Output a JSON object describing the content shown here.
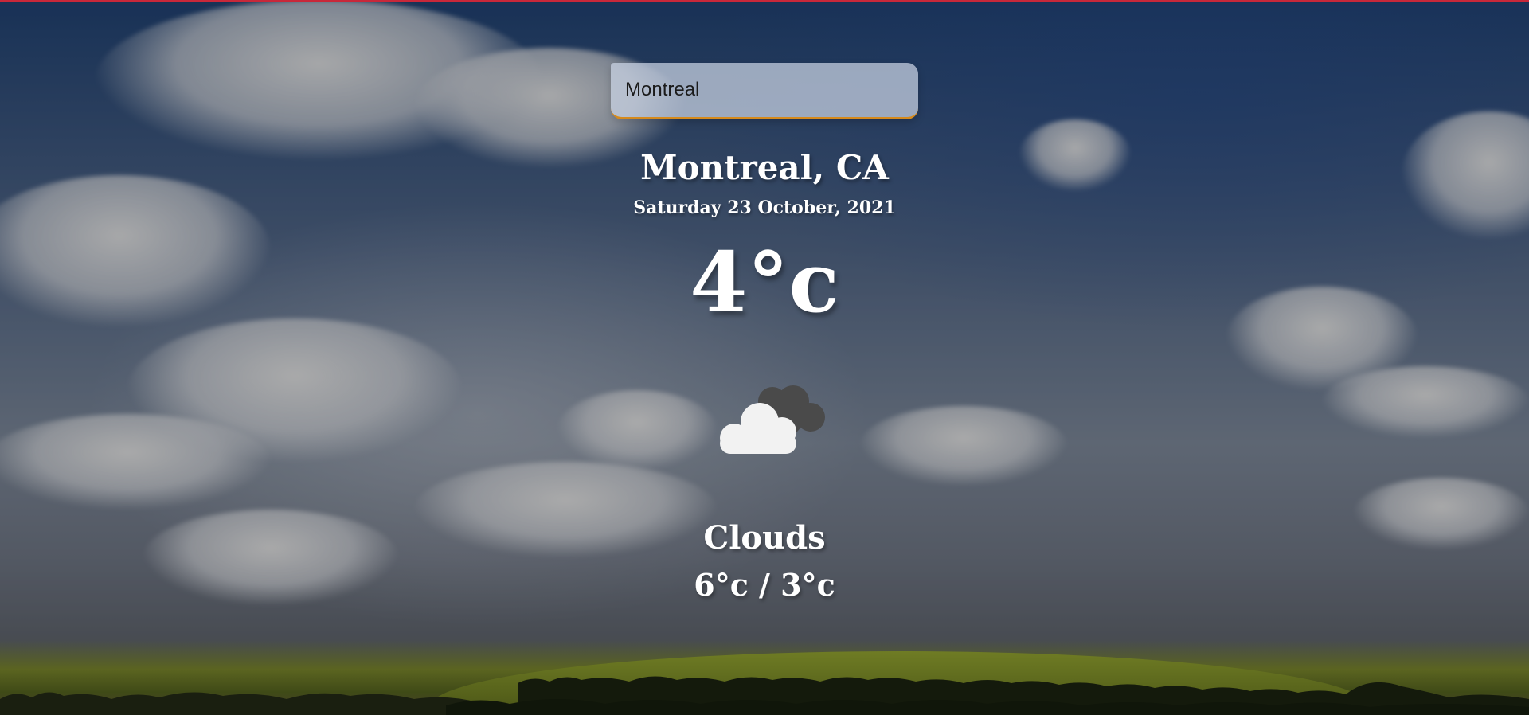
{
  "search": {
    "value": "Montreal",
    "placeholder": ""
  },
  "weather": {
    "location": "Montreal, CA",
    "date": "Saturday 23 October, 2021",
    "temperature": "4°c",
    "condition": "Clouds",
    "hi_lo": "6°c / 3°c",
    "icon": "clouds-icon"
  },
  "colors": {
    "accent_top": "#c8283a",
    "input_underline": "#d68a1c",
    "text": "#ffffff"
  }
}
